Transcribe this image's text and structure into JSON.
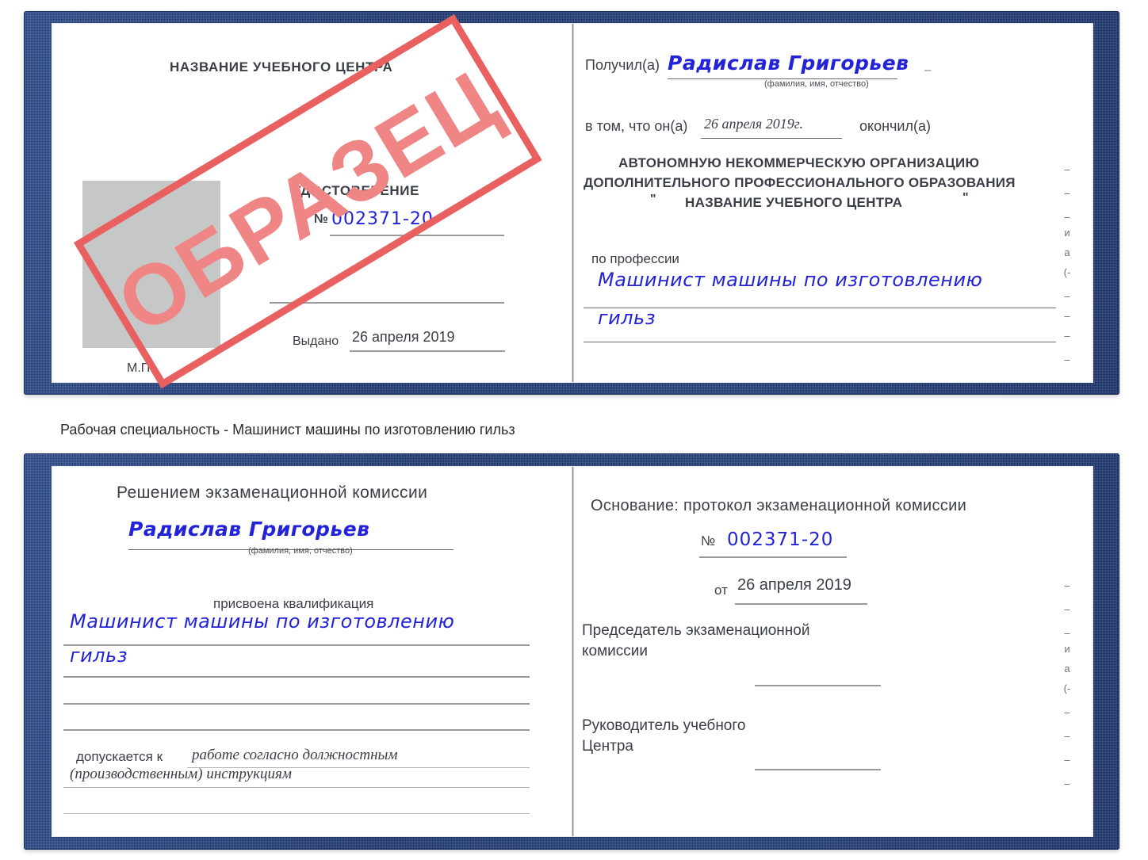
{
  "document": {
    "caption": "Рабочая специальность - Машинист машины по изготовлению гильз",
    "watermark": "ОБРАЗЕЦ"
  },
  "certificate_top": {
    "left_page": {
      "center_name": "НАЗВАНИЕ УЧЕБНОГО ЦЕНТРА",
      "title": "УДОСТОВЕРЕНИЕ",
      "number_label": "№",
      "number_value": "002371-20",
      "issued_label": "Выдано",
      "issued_value": "26 апреля 2019",
      "seal_label": "М.П."
    },
    "right_page": {
      "received_label": "Получил(а)",
      "received_value": "Радислав Григорьев",
      "received_hint": "(фамилия, имя, отчество)",
      "that_label": "в том, что он(а)",
      "completion_date": "26 апреля 2019г.",
      "finished_label": "окончил(а)",
      "org_line_1": "АВТОНОМНУЮ НЕКОММЕРЧЕСКУЮ ОРГАНИЗАЦИЮ",
      "org_line_2": "ДОПОЛНИТЕЛЬНОГО ПРОФЕССИОНАЛЬНОГО ОБРАЗОВАНИЯ",
      "org_quote_open": "\"",
      "org_line_3": "НАЗВАНИЕ УЧЕБНОГО ЦЕНТРА",
      "org_quote_close": "\"",
      "profession_label": "по профессии",
      "profession_value_line_1": "Машинист машины по изготовлению",
      "profession_value_line_2": "гильз",
      "edge_fragments": [
        "–",
        "–",
        "–",
        "и",
        "а",
        "(-",
        "–",
        "–",
        "–",
        "–"
      ]
    }
  },
  "certificate_bottom": {
    "left_page": {
      "heading": "Решением экзаменационной комиссии",
      "name_value": "Радислав Григорьев",
      "name_hint": "(фамилия, имя, отчество)",
      "qualification_label": "присвоена квалификация",
      "qualification_line_1": "Машинист машины по изготовлению",
      "qualification_line_2": "гильз",
      "admitted_label": "допускается к",
      "admitted_line_1": "работе согласно должностным",
      "admitted_line_2": "(производственным) инструкциям"
    },
    "right_page": {
      "basis_label": "Основание: протокол экзаменационной комиссии",
      "number_label": "№",
      "number_value": "002371-20",
      "date_label": "от",
      "date_value": "26 апреля 2019",
      "chairman_line_1": "Председатель экзаменационной",
      "chairman_line_2": "комиссии",
      "head_line_1": "Руководитель учебного",
      "head_line_2": "Центра",
      "edge_fragments": [
        "–",
        "–",
        "–",
        "и",
        "а",
        "(-",
        "–",
        "–",
        "–",
        "–"
      ]
    }
  },
  "colors": {
    "cover_blue": "#24427f",
    "ink_blue": "#2222d8",
    "stamp_red": "#e86060",
    "stamp_fill": "#ef8585",
    "photo_gray": "#c6c8c8",
    "rule_gray": "#9a9a9a",
    "text_gray": "#3a3f47"
  }
}
